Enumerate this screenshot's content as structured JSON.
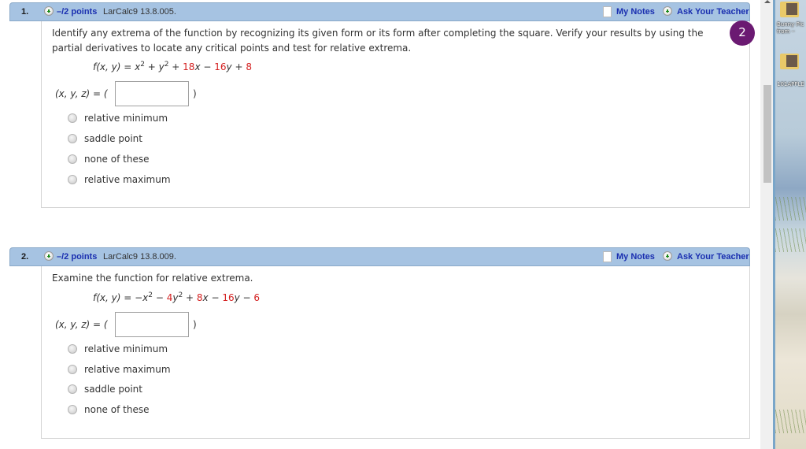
{
  "questions": [
    {
      "number": "1.",
      "points": "–/2 points",
      "reference": "LarCalc9 13.8.005.",
      "my_notes": "My Notes",
      "ask_teacher": "Ask Your Teacher",
      "prompt_line1": "Identify any extrema of the function by recognizing its given form or its form after completing the square. Verify your results by using the",
      "prompt_line2": "partial derivatives to locate any critical points and test for relative extrema.",
      "formula": {
        "lhs": "f(x, y) = ",
        "t1_sign": "",
        "t1": "x",
        "t1_exp": "2",
        "op1": " + ",
        "t2_coef": "",
        "t2": "y",
        "t2_exp": "2",
        "op2": " + ",
        "t3_coef": "18",
        "t3": "x",
        "op3": " − ",
        "t4_coef": "16",
        "t4": "y",
        "op4": " + ",
        "const": "8"
      },
      "answer_label": "(x, y, z) = (",
      "answer_close": ")",
      "answer_value": "",
      "options": [
        "relative minimum",
        "saddle point",
        "none of these",
        "relative maximum"
      ]
    },
    {
      "number": "2.",
      "points": "–/2 points",
      "reference": "LarCalc9 13.8.009.",
      "my_notes": "My Notes",
      "ask_teacher": "Ask Your Teacher",
      "prompt_line1": "Examine the function for relative extrema.",
      "formula": {
        "lhs": "f(x, y) = ",
        "t1_sign": "−",
        "t1": "x",
        "t1_exp": "2",
        "op1": " − ",
        "t2_coef": "4",
        "t2": "y",
        "t2_exp": "2",
        "op2": " + ",
        "t3_coef": "8",
        "t3": "x",
        "op3": " − ",
        "t4_coef": "16",
        "t4": "y",
        "op4": " − ",
        "const": "6"
      },
      "answer_label": "(x, y, z) = (",
      "answer_close": ")",
      "answer_value": "",
      "options": [
        "relative minimum",
        "relative maximum",
        "saddle point",
        "none of these"
      ]
    }
  ],
  "badge": {
    "count": "2",
    "color": "#6b1a72"
  },
  "desktop": {
    "icons": [
      {
        "label": "Bunny Pic",
        "label2": "from ··"
      },
      {
        "label": "101APPLE"
      }
    ]
  },
  "colors": {
    "header_bg": "#a6c3e2",
    "link": "#1a2fb0",
    "coefficient": "#d42020"
  }
}
